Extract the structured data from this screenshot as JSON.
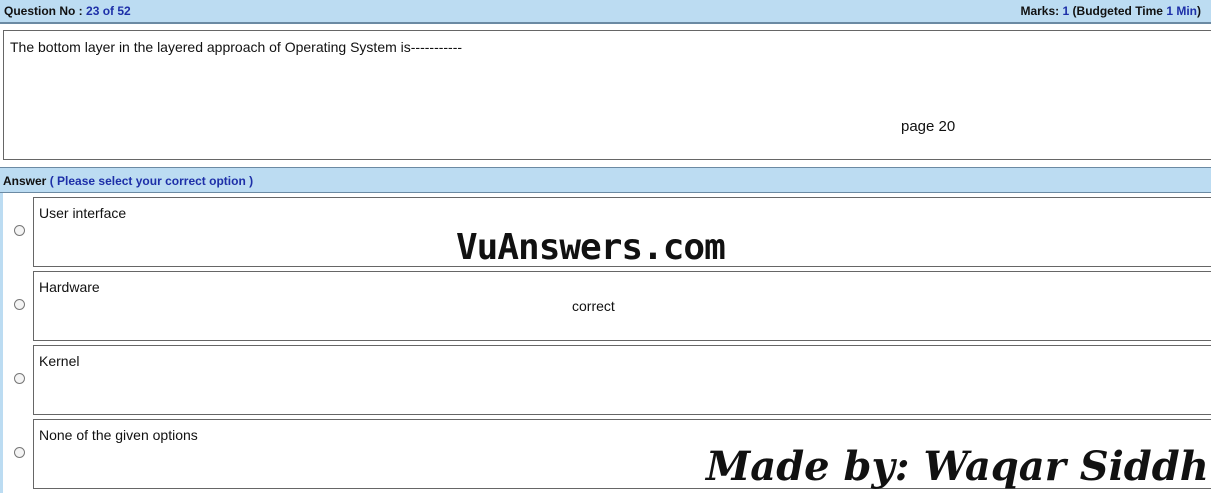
{
  "header": {
    "question_label": "Question No :",
    "question_progress": "23 of 52",
    "marks_label": "Marks:",
    "marks_value": "1",
    "budget_label": "(Budgeted Time",
    "budget_value": "1 Min",
    "budget_close": ")"
  },
  "question": {
    "text": "The bottom layer in the layered approach of Operating System is-----------",
    "page_ref": "page 20"
  },
  "answer_bar": {
    "label": "Answer",
    "instruction": "( Please select your correct option )"
  },
  "options": [
    {
      "label": "User interface"
    },
    {
      "label": "Hardware"
    },
    {
      "label": "Kernel"
    },
    {
      "label": "None of the given options"
    }
  ],
  "correct_note": "correct",
  "watermarks": {
    "site": "VuAnswers.com",
    "author": "Made by: Waqar Siddhu"
  },
  "colors": {
    "bar_bg": "#bcdcf2",
    "accent_text": "#1d2fa8"
  }
}
